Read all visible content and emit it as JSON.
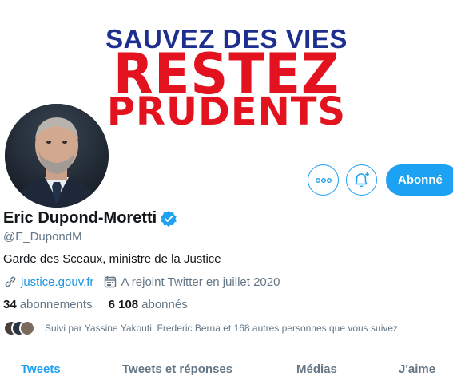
{
  "banner": {
    "line1": "SAUVEZ DES VIES",
    "line2": "RESTEZ",
    "line3": "PRUDENTS"
  },
  "actions": {
    "follow_label": "Abonné"
  },
  "profile": {
    "name": "Eric Dupond-Moretti",
    "verified": true,
    "handle": "@E_DupondM",
    "bio": "Garde des Sceaux, ministre de la Justice",
    "link": "justice.gouv.fr",
    "joined": "A rejoint Twitter en juillet 2020",
    "following_count": "34",
    "following_label": "abonnements",
    "followers_count": "6 108",
    "followers_label": "abonnés",
    "followed_by": "Suivi par Yassine Yakouti, Frederic Berna et 168 autres personnes que vous suivez"
  },
  "tabs": [
    {
      "label": "Tweets",
      "active": true
    },
    {
      "label": "Tweets et réponses",
      "active": false
    },
    {
      "label": "Médias",
      "active": false
    },
    {
      "label": "J'aime",
      "active": false
    }
  ],
  "colors": {
    "accent": "#1da1f2",
    "banner_blue": "#1d2e8f",
    "banner_red": "#e2121e",
    "muted": "#657786"
  }
}
